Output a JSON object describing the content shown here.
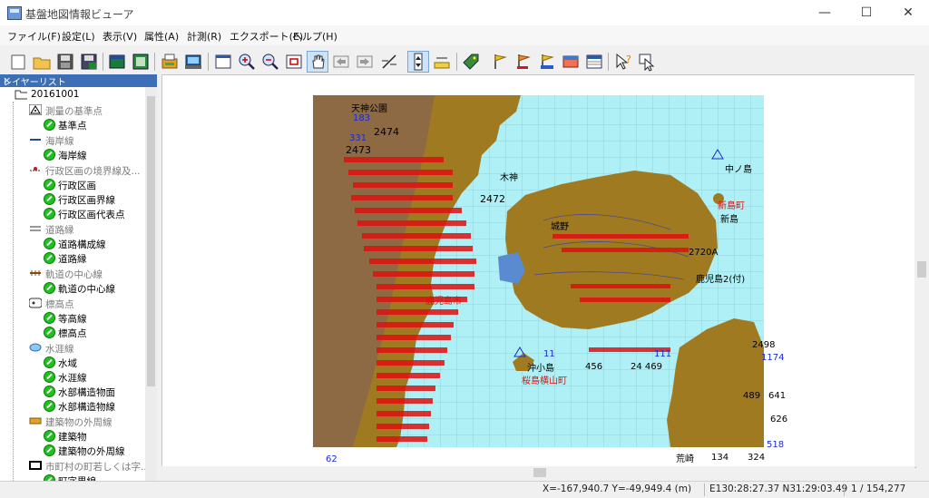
{
  "window": {
    "title": "基盤地図情報ビューア",
    "buttons": {
      "minimize": "—",
      "maximize": "☐",
      "close": "✕"
    }
  },
  "menu": [
    "ファイル(F)",
    "設定(L)",
    "表示(V)",
    "属性(A)",
    "計測(R)",
    "エクスポート(E)",
    "ヘルプ(H)"
  ],
  "toolbar": {
    "icons": [
      "new-icon",
      "open-icon",
      "save-icon",
      "save-as-icon",
      "map-frame-icon",
      "layer-frame-icon",
      "print-setup-icon",
      "print-icon",
      "full-extent-icon",
      "zoom-in-icon",
      "zoom-out-icon",
      "zoom-box-icon",
      "pan-hand-icon",
      "back-icon",
      "forward-icon",
      "measure-icon",
      "scale-bar-icon",
      "ruler-icon",
      "tag-icon",
      "flag-yellow-icon",
      "flag-orange-icon",
      "flag-multi-icon",
      "legend-icon",
      "attribute-table-icon",
      "help-cursor-icon",
      "select-cursor-icon"
    ]
  },
  "layer_panel": {
    "title": "レイヤーリスト",
    "close": "×",
    "root": "20161001",
    "groups": [
      {
        "label": "測量の基準点",
        "icon": "triangle-icon",
        "children": [
          "基準点"
        ]
      },
      {
        "label": "海岸線",
        "icon": "line-blue-icon",
        "children": [
          "海岸線"
        ]
      },
      {
        "label": "行政区画の境界線及...",
        "icon": "boundary-icon",
        "children": [
          "行政区画",
          "行政区画界線",
          "行政区画代表点"
        ]
      },
      {
        "label": "道路縁",
        "icon": "road-icon",
        "children": [
          "道路構成線",
          "道路縁"
        ]
      },
      {
        "label": "軌道の中心線",
        "icon": "rail-icon",
        "children": [
          "軌道の中心線"
        ]
      },
      {
        "label": "標高点",
        "icon": "elevation-icon",
        "children": [
          "等高線",
          "標高点"
        ]
      },
      {
        "label": "水涯線",
        "icon": "water-icon",
        "children": [
          "水域",
          "水涯線",
          "水部構造物面",
          "水部構造物線"
        ]
      },
      {
        "label": "建築物の外周線",
        "icon": "building-icon",
        "children": [
          "建築物",
          "建築物の外周線"
        ]
      },
      {
        "label": "市町村の町若しくは字...",
        "icon": "town-icon",
        "children": [
          "町字界線"
        ]
      }
    ]
  },
  "map": {
    "colors": {
      "sea": "#aef0f5",
      "land": "#a07a20",
      "grid": "#7ccfe0"
    },
    "labels": [
      {
        "text": "天神公園",
        "c": "k"
      },
      {
        "text": "183",
        "c": "b"
      },
      {
        "text": "2474",
        "c": "k"
      },
      {
        "text": "331",
        "c": "b"
      },
      {
        "text": "2473",
        "c": "k"
      },
      {
        "text": "中ノ島",
        "c": "k"
      },
      {
        "text": "木神",
        "c": "k"
      },
      {
        "text": "2472",
        "c": "k"
      },
      {
        "text": "新島町",
        "c": "r"
      },
      {
        "text": "新島",
        "c": "k"
      },
      {
        "text": "城野",
        "c": "k"
      },
      {
        "text": "2720A",
        "c": "k"
      },
      {
        "text": "鹿児島2(付)",
        "c": "k"
      },
      {
        "text": "鹿児島市",
        "c": "r"
      },
      {
        "text": "沖小島",
        "c": "k"
      },
      {
        "text": "桜島横山町",
        "c": "r"
      },
      {
        "text": "2498",
        "c": "k"
      },
      {
        "text": "1174",
        "c": "b"
      },
      {
        "text": "489",
        "c": "k"
      },
      {
        "text": "641",
        "c": "k"
      },
      {
        "text": "626",
        "c": "k"
      },
      {
        "text": "518",
        "c": "b"
      },
      {
        "text": "134",
        "c": "k"
      },
      {
        "text": "324",
        "c": "k"
      },
      {
        "text": "荒崎",
        "c": "k"
      },
      {
        "text": "24 469",
        "c": "k"
      },
      {
        "text": "111",
        "c": "b"
      },
      {
        "text": "11",
        "c": "b"
      },
      {
        "text": "456",
        "c": "k"
      },
      {
        "text": "62",
        "c": "b"
      }
    ]
  },
  "status": {
    "xy": "X=-167,940.7 Y=-49,949.4 (m)",
    "lonlat": "E130:28:27.37 N31:29:03.49",
    "scale": "1 / 154,277"
  }
}
